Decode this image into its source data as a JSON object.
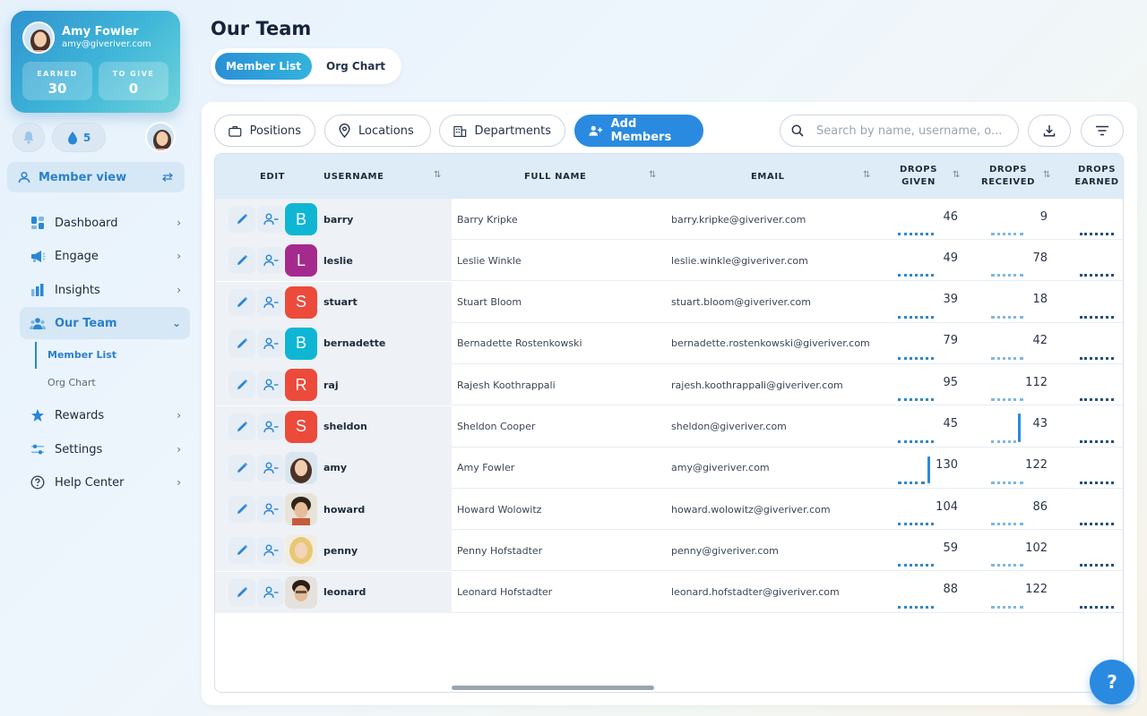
{
  "profile": {
    "name": "Amy Fowler",
    "email": "amy@giveriver.com",
    "earned_label": "EARNED",
    "earned_value": "30",
    "to_give_label": "TO GIVE",
    "to_give_value": "0"
  },
  "quick": {
    "drops_count": "5"
  },
  "sidebar": {
    "member_view_label": "Member view",
    "items": [
      {
        "label": "Dashboard",
        "icon": "dashboard-icon"
      },
      {
        "label": "Engage",
        "icon": "megaphone-icon"
      },
      {
        "label": "Insights",
        "icon": "bar-chart-icon"
      },
      {
        "label": "Our Team",
        "icon": "team-icon"
      },
      {
        "label": "Rewards",
        "icon": "star-icon"
      },
      {
        "label": "Settings",
        "icon": "sliders-icon"
      },
      {
        "label": "Help Center",
        "icon": "help-circle-icon"
      }
    ],
    "subitems": [
      {
        "label": "Member List",
        "active": true
      },
      {
        "label": "Org Chart",
        "active": false
      }
    ]
  },
  "page": {
    "title": "Our Team",
    "tabs": [
      "Member List",
      "Org Chart"
    ]
  },
  "toolbar": {
    "positions": "Positions",
    "locations": "Locations",
    "departments": "Departments",
    "add_members": "Add Members",
    "search_placeholder": "Search by name, username, o..."
  },
  "table": {
    "headers": {
      "edit": "EDIT",
      "username": "USERNAME",
      "full_name": "FULL NAME",
      "email": "EMAIL",
      "drops_given_1": "DROPS",
      "drops_given_2": "GIVEN",
      "drops_received_1": "DROPS",
      "drops_received_2": "RECEIVED",
      "drops_earned_1": "DROPS",
      "drops_earned_2": "EARNED"
    },
    "rows": [
      {
        "username": "barry",
        "initial": "B",
        "color": "#0fb6d4",
        "full_name": "Barry Kripke",
        "email": "barry.kripke@giveriver.com",
        "given": "46",
        "received": "9"
      },
      {
        "username": "leslie",
        "initial": "L",
        "color": "#a52a8e",
        "full_name": "Leslie Winkle",
        "email": "leslie.winkle@giveriver.com",
        "given": "49",
        "received": "78"
      },
      {
        "username": "stuart",
        "initial": "S",
        "color": "#ec4a3a",
        "full_name": "Stuart Bloom",
        "email": "stuart.bloom@giveriver.com",
        "given": "39",
        "received": "18"
      },
      {
        "username": "bernadette",
        "initial": "B",
        "color": "#0fb6d4",
        "full_name": "Bernadette Rostenkowski",
        "email": "bernadette.rostenkowski@giveriver.com",
        "given": "79",
        "received": "42"
      },
      {
        "username": "raj",
        "initial": "R",
        "color": "#ec4a3a",
        "full_name": "Rajesh Koothrappali",
        "email": "rajesh.koothrappali@giveriver.com",
        "given": "95",
        "received": "112"
      },
      {
        "username": "sheldon",
        "initial": "S",
        "color": "#ec4a3a",
        "full_name": "Sheldon Cooper",
        "email": "sheldon@giveriver.com",
        "given": "45",
        "received": "43"
      },
      {
        "username": "amy",
        "initial": "",
        "color": "#d9b89a",
        "full_name": "Amy Fowler",
        "email": "amy@giveriver.com",
        "given": "130",
        "received": "122"
      },
      {
        "username": "howard",
        "initial": "",
        "color": "#c7a27c",
        "full_name": "Howard Wolowitz",
        "email": "howard.wolowitz@giveriver.com",
        "given": "104",
        "received": "86"
      },
      {
        "username": "penny",
        "initial": "",
        "color": "#f0d58c",
        "full_name": "Penny Hofstadter",
        "email": "penny@giveriver.com",
        "given": "59",
        "received": "102"
      },
      {
        "username": "leonard",
        "initial": "",
        "color": "#8a6a52",
        "full_name": "Leonard Hofstadter",
        "email": "leonard.hofstadter@giveriver.com",
        "given": "88",
        "received": "122"
      }
    ]
  },
  "help_label": "?"
}
